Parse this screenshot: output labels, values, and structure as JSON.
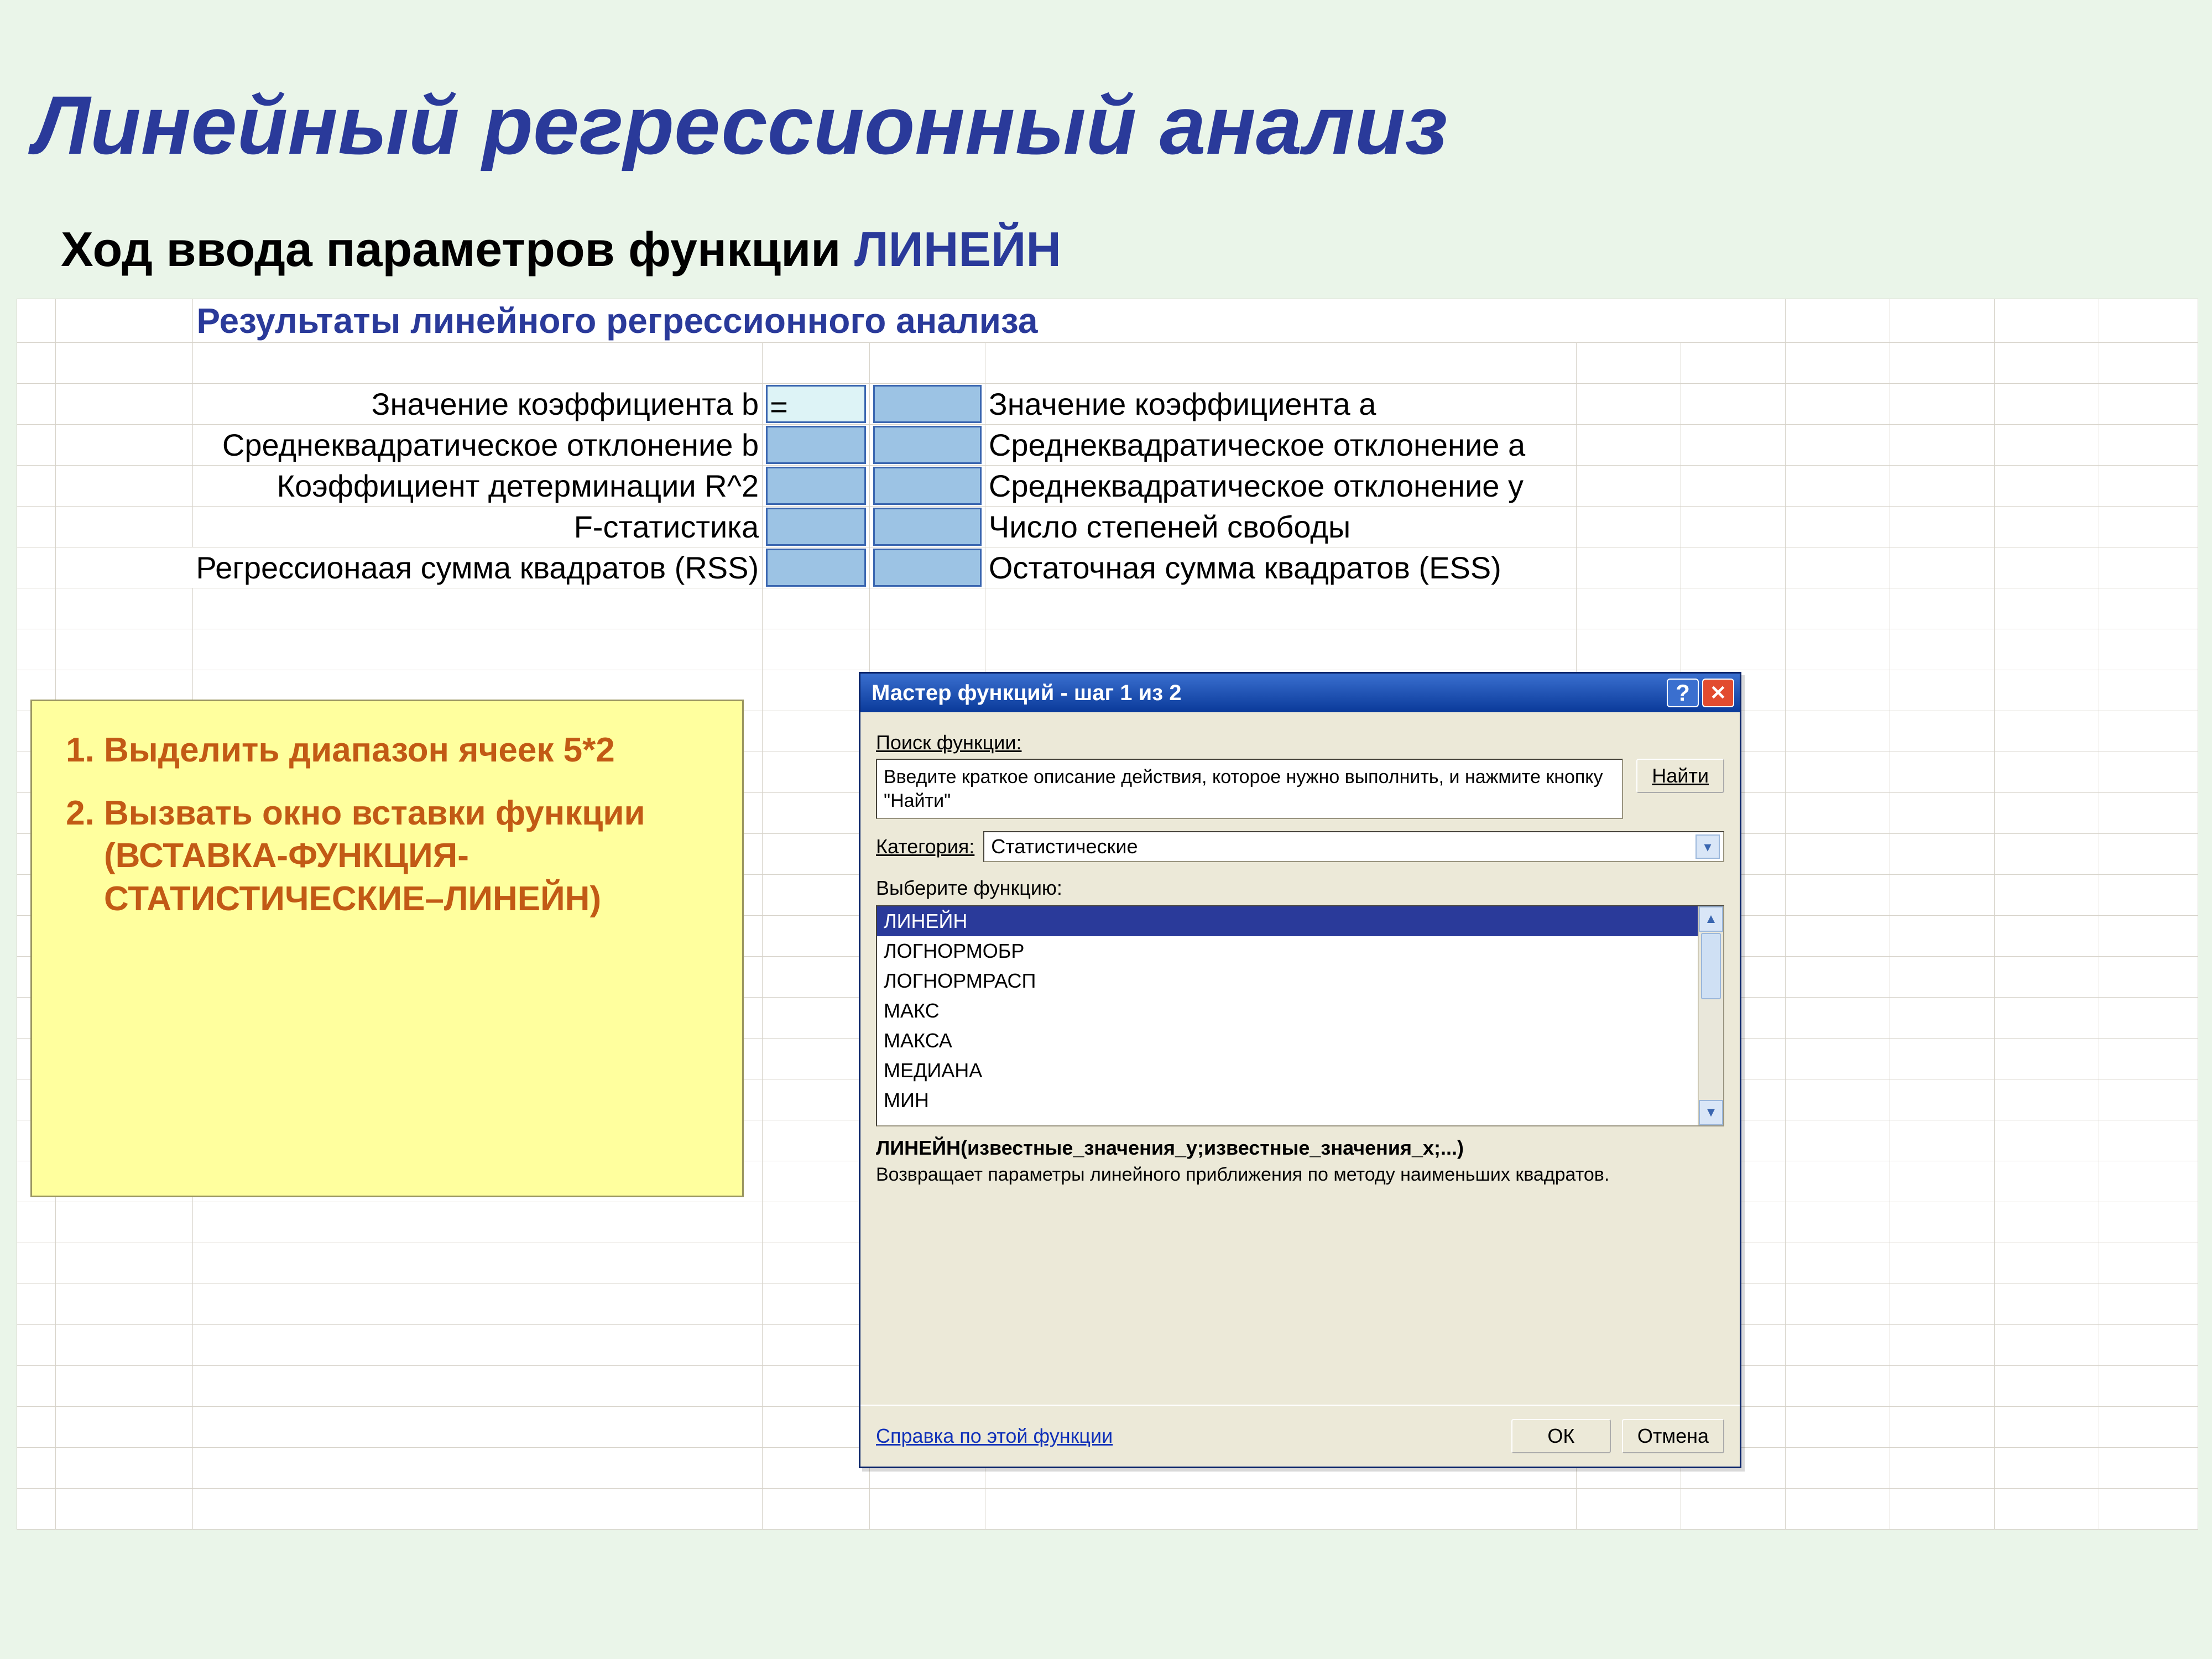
{
  "slide": {
    "title": "Линейный регрессионный анализ",
    "subtitle_prefix": "Ход ввода параметров функции ",
    "subtitle_fn": "ЛИНЕЙН"
  },
  "sheet": {
    "header": "Результаты линейного регрессионного анализа",
    "rows": [
      {
        "left": "Значение коэффициента b",
        "right": "Значение коэффициента a"
      },
      {
        "left": "Среднеквадратическое отклонение b",
        "right": "Среднеквадратическое отклонение a"
      },
      {
        "left": "Коэффициент детерминации R^2",
        "right": "Среднеквадратическое отклонение y"
      },
      {
        "left": "F-статистика",
        "right": "Число степеней свободы"
      },
      {
        "left": "Регрессионаая сумма квадратов (RSS)",
        "right": "Остаточная сумма квадратов (ESS)"
      }
    ],
    "active_cell_text": "="
  },
  "steps": {
    "items": [
      "Выделить диапазон ячеек 5*2",
      "Вызвать окно вставки функции (ВСТАВКА-ФУНКЦИЯ-СТАТИСТИЧЕСКИЕ–ЛИНЕЙН)"
    ]
  },
  "dialog": {
    "title": "Мастер функций - шаг 1 из 2",
    "help_glyph": "?",
    "close_glyph": "✕",
    "search_label": "Поиск функции:",
    "search_text": "Введите краткое описание действия, которое нужно выполнить, и нажмите кнопку \"Найти\"",
    "find_btn": "Найти",
    "category_label": "Категория:",
    "category_value": "Статистические",
    "choose_label": "Выберите функцию:",
    "functions": [
      "ЛИНЕЙН",
      "ЛОГНОРМОБР",
      "ЛОГНОРМРАСП",
      "МАКС",
      "МАКСА",
      "МЕДИАНА",
      "МИН"
    ],
    "signature": "ЛИНЕЙН(известные_значения_y;известные_значения_x;...)",
    "description": "Возвращает параметры линейного приближения по методу наименьших квадратов.",
    "help_link": "Справка по этой функции",
    "ok": "ОК",
    "cancel": "Отмена"
  }
}
